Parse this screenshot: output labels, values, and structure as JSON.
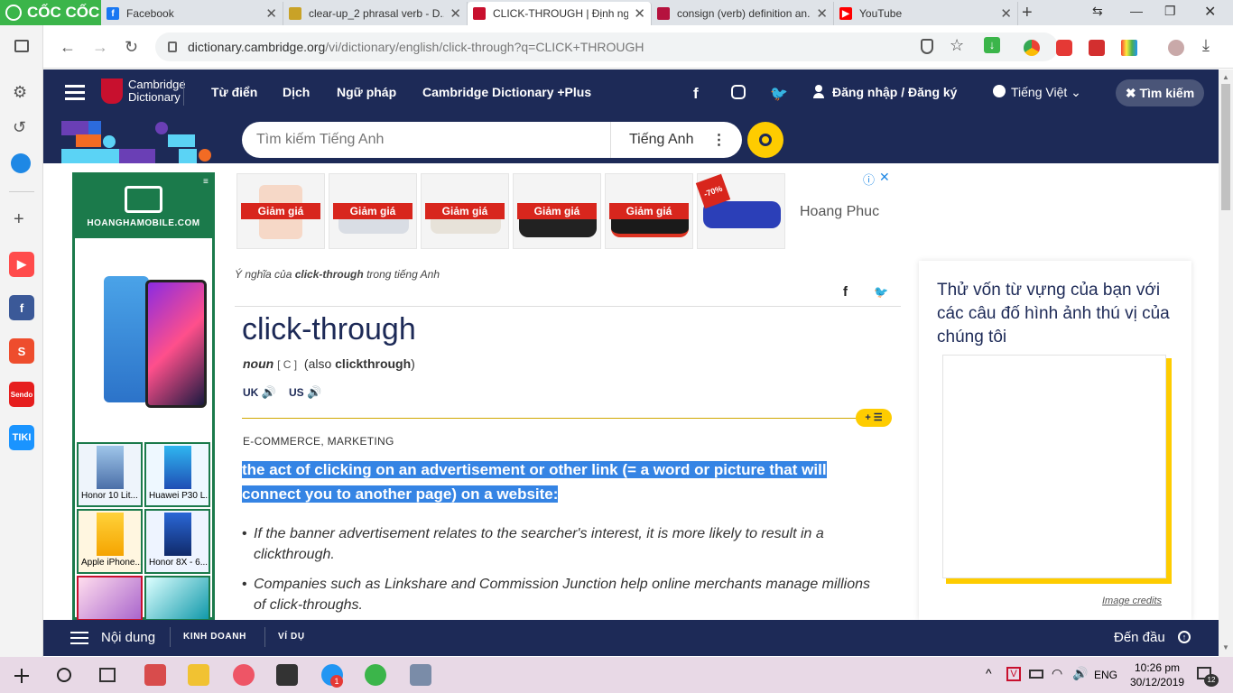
{
  "browser": {
    "brand": "CỐC CỐC",
    "tabs": [
      {
        "title": "Facebook",
        "fav": "f",
        "color": "#1877f2"
      },
      {
        "title": "clear-up_2 phrasal verb - D...",
        "fav": "",
        "color": "#c9a227"
      },
      {
        "title": "CLICK-THROUGH | Định ngh...",
        "fav": "",
        "color": "#c8102e",
        "active": true
      },
      {
        "title": "consign (verb) definition an...",
        "fav": "",
        "color": "#b5123e"
      },
      {
        "title": "YouTube",
        "fav": "▶",
        "color": "#ff0000"
      }
    ],
    "url_host": "dictionary.cambridge.org",
    "url_path": "/vi/dictionary/english/click-through?q=CLICK+THROUGH"
  },
  "sidebar": {
    "icons": [
      "settings-icon",
      "history-icon",
      "messenger-icon",
      "add-icon",
      "youtube-icon",
      "facebook-icon",
      "shopee-icon",
      "sendo-icon",
      "tiki-icon"
    ],
    "tiki": "TIKI",
    "sendo": "Sendo"
  },
  "header": {
    "logo_line1": "Cambridge",
    "logo_line2": "Dictionary",
    "nav": [
      "Từ điển",
      "Dịch",
      "Ngữ pháp",
      "Cambridge Dictionary +Plus"
    ],
    "login": "Đăng nhập / Đăng ký",
    "lang": "Tiếng Việt",
    "search_label": "Tìm kiếm"
  },
  "search": {
    "placeholder": "Tìm kiếm Tiếng Anh",
    "lang": "Tiếng Anh"
  },
  "ad_left": {
    "brand": "HOANGHAMOBILE.COM",
    "phones": [
      "Honor 10 Lit...",
      "Huawei P30 L...",
      "Apple iPhone...",
      "Honor 8X - 6..."
    ]
  },
  "ad_top": {
    "sale": "Giảm giá",
    "discount": "-70%",
    "advertiser": "Hoang Phuc"
  },
  "entry": {
    "crumb_pre": "Ý nghĩa của ",
    "crumb_word": "click-through",
    "crumb_post": " trong tiếng Anh",
    "headword": "click-through",
    "pos": "noun",
    "gram": "[ C ]",
    "also_pre": "(also ",
    "also_word": "clickthrough",
    "also_post": ")",
    "uk": "UK",
    "us": "US",
    "plus": "+ ☰",
    "topics": "E-COMMERCE, MARKETING",
    "definition": "the act of clicking on an advertisement or other link (= a word or picture that will connect you to another page) on a website:",
    "examples": [
      "If the banner advertisement relates to the searcher's interest, it is more likely to result in a clickthrough.",
      "Companies such as Linkshare and Commission Junction help online merchants manage millions of click-throughs."
    ]
  },
  "quiz": {
    "title": "Thử vốn từ vựng của bạn với các câu đố hình ảnh thú vị của chúng tôi",
    "credits": "Image credits"
  },
  "bottom": {
    "contents": "Nội dung",
    "tab1": "KINH DOANH",
    "tab2": "VÍ DỤ",
    "top": "Đến đầu"
  },
  "taskbar": {
    "lang": "ENG",
    "time": "10:26 pm",
    "date": "30/12/2019",
    "notif": "12",
    "badge": "1"
  }
}
